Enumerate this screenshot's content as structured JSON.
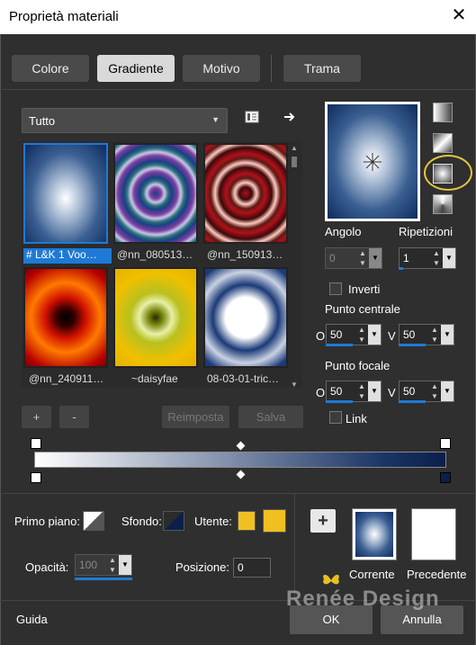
{
  "window": {
    "title": "Proprietà materiali",
    "close_label": "✕"
  },
  "tabs": [
    {
      "label": "Colore"
    },
    {
      "label": "Gradiente"
    },
    {
      "label": "Motivo"
    },
    {
      "label": "Trama"
    }
  ],
  "category": {
    "value": "Tutto"
  },
  "gallery": {
    "items": [
      {
        "caption": "# L&K 1 Voo…"
      },
      {
        "caption": "@nn_080513…"
      },
      {
        "caption": "@nn_150913…"
      },
      {
        "caption": "@nn_240911…"
      },
      {
        "caption": "~daisyfae"
      },
      {
        "caption": "08-03-01-tric…"
      }
    ]
  },
  "gallery_buttons": {
    "add": "+",
    "remove": "-",
    "reset": "Reimposta",
    "save": "Salva"
  },
  "properties": {
    "angle_label": "Angolo",
    "angle_value": "0",
    "repeats_label": "Ripetizioni",
    "repeats_value": "1",
    "invert_label": "Inverti",
    "center_label": "Punto centrale",
    "center_h_prefix": "O",
    "center_h": "50",
    "center_v_prefix": "V",
    "center_v": "50",
    "focal_label": "Punto focale",
    "focal_h_prefix": "O",
    "focal_h": "50",
    "focal_v_prefix": "V",
    "focal_v": "50",
    "link_label": "Link"
  },
  "bottom": {
    "foreground_label": "Primo piano:",
    "background_label": "Sfondo:",
    "user_label": "Utente:",
    "opacity_label": "Opacità:",
    "opacity_value": "100",
    "position_label": "Posizione:",
    "position_value": "0",
    "current_label": "Corrente",
    "previous_label": "Precedente",
    "add_label": "+",
    "user_color": "#f0c020"
  },
  "footer": {
    "help": "Guida",
    "ok": "OK",
    "cancel": "Annulla",
    "watermark": "Renée Design"
  }
}
